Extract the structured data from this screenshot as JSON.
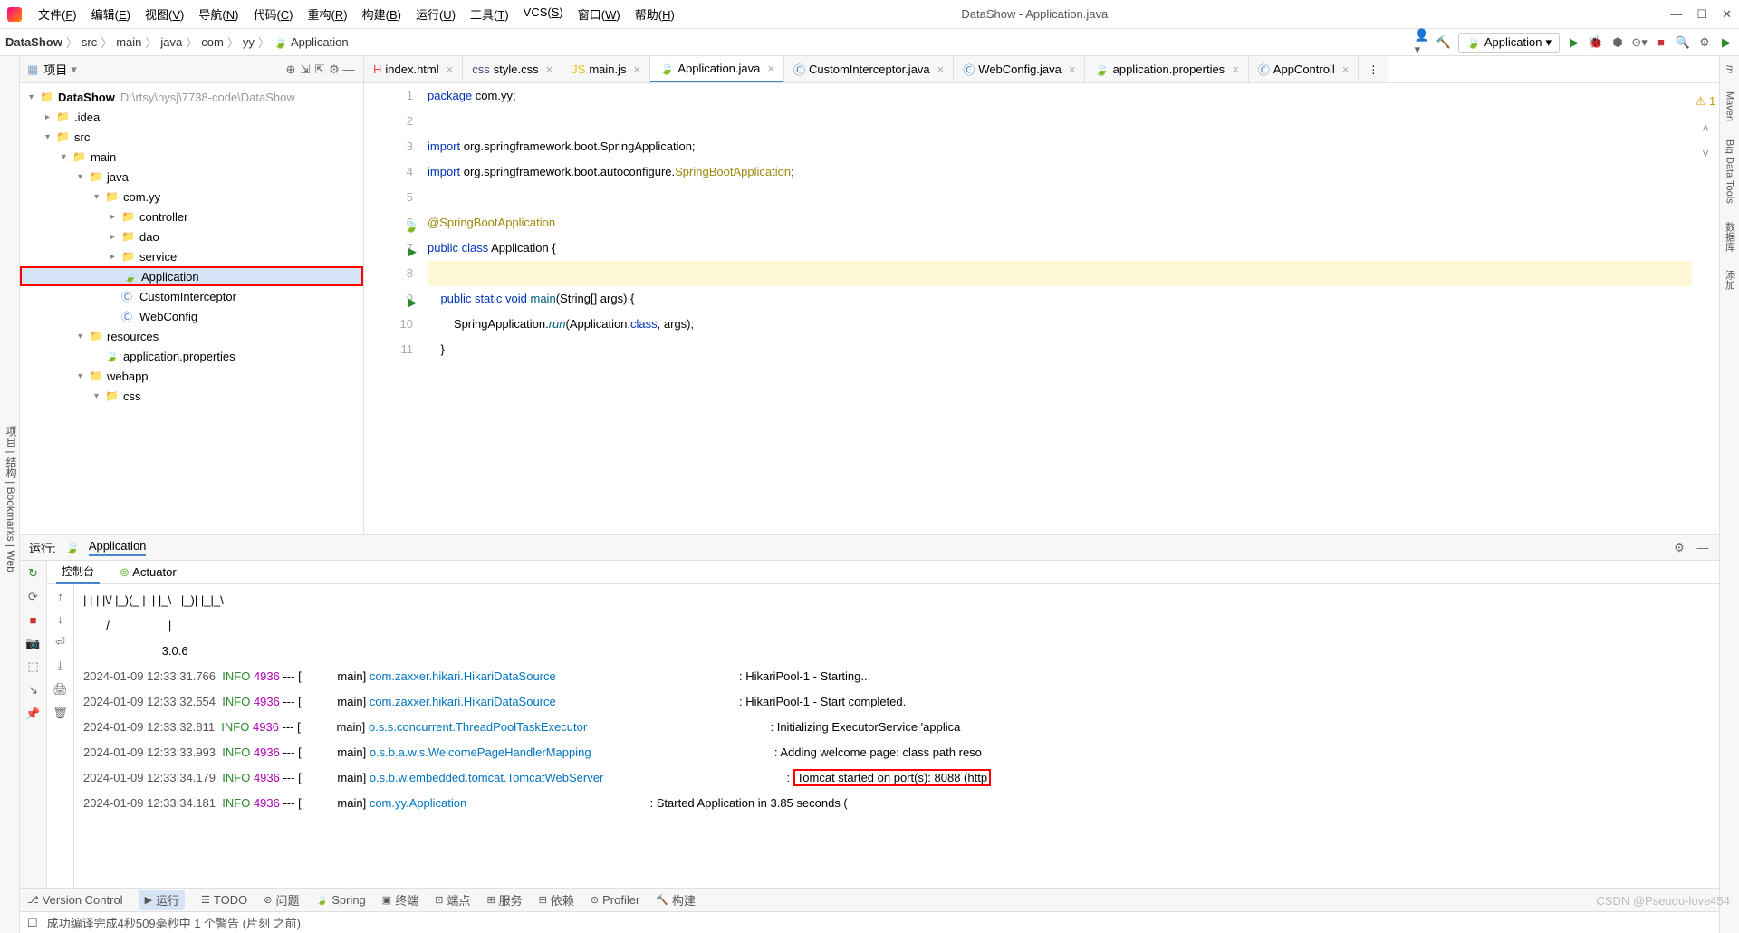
{
  "window": {
    "title": "DataShow - Application.java"
  },
  "menu": [
    "文件(F)",
    "编辑(E)",
    "视图(V)",
    "导航(N)",
    "代码(C)",
    "重构(R)",
    "构建(B)",
    "运行(U)",
    "工具(T)",
    "VCS(S)",
    "窗口(W)",
    "帮助(H)"
  ],
  "breadcrumb": [
    "DataShow",
    "src",
    "main",
    "java",
    "com",
    "yy",
    "Application"
  ],
  "run_config": "Application",
  "project": {
    "header": "项目",
    "root": {
      "name": "DataShow",
      "path": "D:\\rtsy\\bysj\\7738-code\\DataShow"
    },
    "tree": [
      {
        "indent": 0,
        "arrow": "▾",
        "icon": "📁",
        "label": "DataShow",
        "path": "D:\\rtsy\\bysj\\7738-code\\DataShow",
        "bold": true
      },
      {
        "indent": 1,
        "arrow": "▸",
        "icon": "📁",
        "label": ".idea"
      },
      {
        "indent": 1,
        "arrow": "▾",
        "icon": "📁",
        "label": "src"
      },
      {
        "indent": 2,
        "arrow": "▾",
        "icon": "📁",
        "label": "main"
      },
      {
        "indent": 3,
        "arrow": "▾",
        "icon": "📁",
        "label": "java"
      },
      {
        "indent": 4,
        "arrow": "▾",
        "icon": "📁",
        "label": "com.yy"
      },
      {
        "indent": 5,
        "arrow": "▸",
        "icon": "📁",
        "label": "controller"
      },
      {
        "indent": 5,
        "arrow": "▸",
        "icon": "📁",
        "label": "dao"
      },
      {
        "indent": 5,
        "arrow": "▸",
        "icon": "📁",
        "label": "service"
      },
      {
        "indent": 5,
        "arrow": "",
        "icon": "🍃",
        "label": "Application",
        "selected": true
      },
      {
        "indent": 5,
        "arrow": "",
        "icon": "Ⓒ",
        "label": "CustomInterceptor"
      },
      {
        "indent": 5,
        "arrow": "",
        "icon": "Ⓒ",
        "label": "WebConfig"
      },
      {
        "indent": 3,
        "arrow": "▾",
        "icon": "📁",
        "label": "resources"
      },
      {
        "indent": 4,
        "arrow": "",
        "icon": "🍃",
        "label": "application.properties"
      },
      {
        "indent": 3,
        "arrow": "▾",
        "icon": "📁",
        "label": "webapp"
      },
      {
        "indent": 4,
        "arrow": "▾",
        "icon": "📁",
        "label": "css"
      }
    ]
  },
  "editor_tabs": [
    {
      "label": "index.html",
      "icon": "H",
      "color": "#e44"
    },
    {
      "label": "style.css",
      "icon": "css",
      "color": "#563d7c"
    },
    {
      "label": "main.js",
      "icon": "JS",
      "color": "#f1c40f"
    },
    {
      "label": "Application.java",
      "icon": "🍃",
      "active": true
    },
    {
      "label": "CustomInterceptor.java",
      "icon": "Ⓒ"
    },
    {
      "label": "WebConfig.java",
      "icon": "Ⓒ"
    },
    {
      "label": "application.properties",
      "icon": "🍃"
    },
    {
      "label": "AppControll",
      "icon": "Ⓒ"
    }
  ],
  "code": [
    {
      "n": 1,
      "html": "<span class='kw'>package</span> com.yy;"
    },
    {
      "n": 2,
      "html": ""
    },
    {
      "n": 3,
      "html": "<span class='kw'>import</span> org.springframework.boot.SpringApplication;"
    },
    {
      "n": 4,
      "html": "<span class='kw'>import</span> org.springframework.boot.autoconfigure.<span class='ann'>SpringBootApplication</span>;"
    },
    {
      "n": 5,
      "html": ""
    },
    {
      "n": 6,
      "html": "<span class='ann'>@SpringBootApplication</span>",
      "gutter": "spring"
    },
    {
      "n": 7,
      "html": "<span class='kw'>public</span> <span class='kw'>class</span> <span class='cls'>Application</span> {",
      "gutter": "run"
    },
    {
      "n": 8,
      "html": "",
      "hl": true
    },
    {
      "n": 9,
      "html": "    <span class='kw'>public</span> <span class='kw'>static</span> <span class='kw'>void</span> <span class='fn'>main</span>(String[] args) {",
      "gutter": "run"
    },
    {
      "n": 10,
      "html": "        SpringApplication.<span class='fn-italic'>run</span>(Application.<span class='kw'>class</span>, args);"
    },
    {
      "n": 11,
      "html": "    }"
    }
  ],
  "warnings": "1",
  "run": {
    "label": "运行:",
    "tab": "Application",
    "subtabs": [
      "控制台",
      "Actuator"
    ],
    "spring_version": "3.0.6",
    "ascii": [
      "| | | |\\/ |_)(_ |  | |_\\   |_)| |_|_\\",
      "       /                  |"
    ],
    "logs": [
      {
        "t": "2024-01-09 12:33:31.766",
        "lvl": "INFO",
        "pid": "4936",
        "thread": "main",
        "cls": "com.zaxxer.hikari.HikariDataSource",
        "msg": "HikariPool-1 - Starting..."
      },
      {
        "t": "2024-01-09 12:33:32.554",
        "lvl": "INFO",
        "pid": "4936",
        "thread": "main",
        "cls": "com.zaxxer.hikari.HikariDataSource",
        "msg": "HikariPool-1 - Start completed."
      },
      {
        "t": "2024-01-09 12:33:32.811",
        "lvl": "INFO",
        "pid": "4936",
        "thread": "main",
        "cls": "o.s.s.concurrent.ThreadPoolTaskExecutor",
        "msg": "Initializing ExecutorService 'applica"
      },
      {
        "t": "2024-01-09 12:33:33.993",
        "lvl": "INFO",
        "pid": "4936",
        "thread": "main",
        "cls": "o.s.b.a.w.s.WelcomePageHandlerMapping",
        "msg": "Adding welcome page: class path reso"
      },
      {
        "t": "2024-01-09 12:33:34.179",
        "lvl": "INFO",
        "pid": "4936",
        "thread": "main",
        "cls": "o.s.b.w.embedded.tomcat.TomcatWebServer",
        "msg": "Tomcat started on port(s): 8088 (http",
        "boxed": true
      },
      {
        "t": "2024-01-09 12:33:34.181",
        "lvl": "INFO",
        "pid": "4936",
        "thread": "main",
        "cls": "com.yy.Application",
        "msg": "Started Application in 3.85 seconds ("
      }
    ]
  },
  "bottom_tabs": [
    "Version Control",
    "运行",
    "TODO",
    "问题",
    "Spring",
    "终端",
    "端点",
    "服务",
    "依赖",
    "Profiler",
    "构建"
  ],
  "status": "成功编译完成4秒509毫秒中 1 个警告 (片刻 之前)",
  "watermark": "CSDN @Pseudo-love454"
}
